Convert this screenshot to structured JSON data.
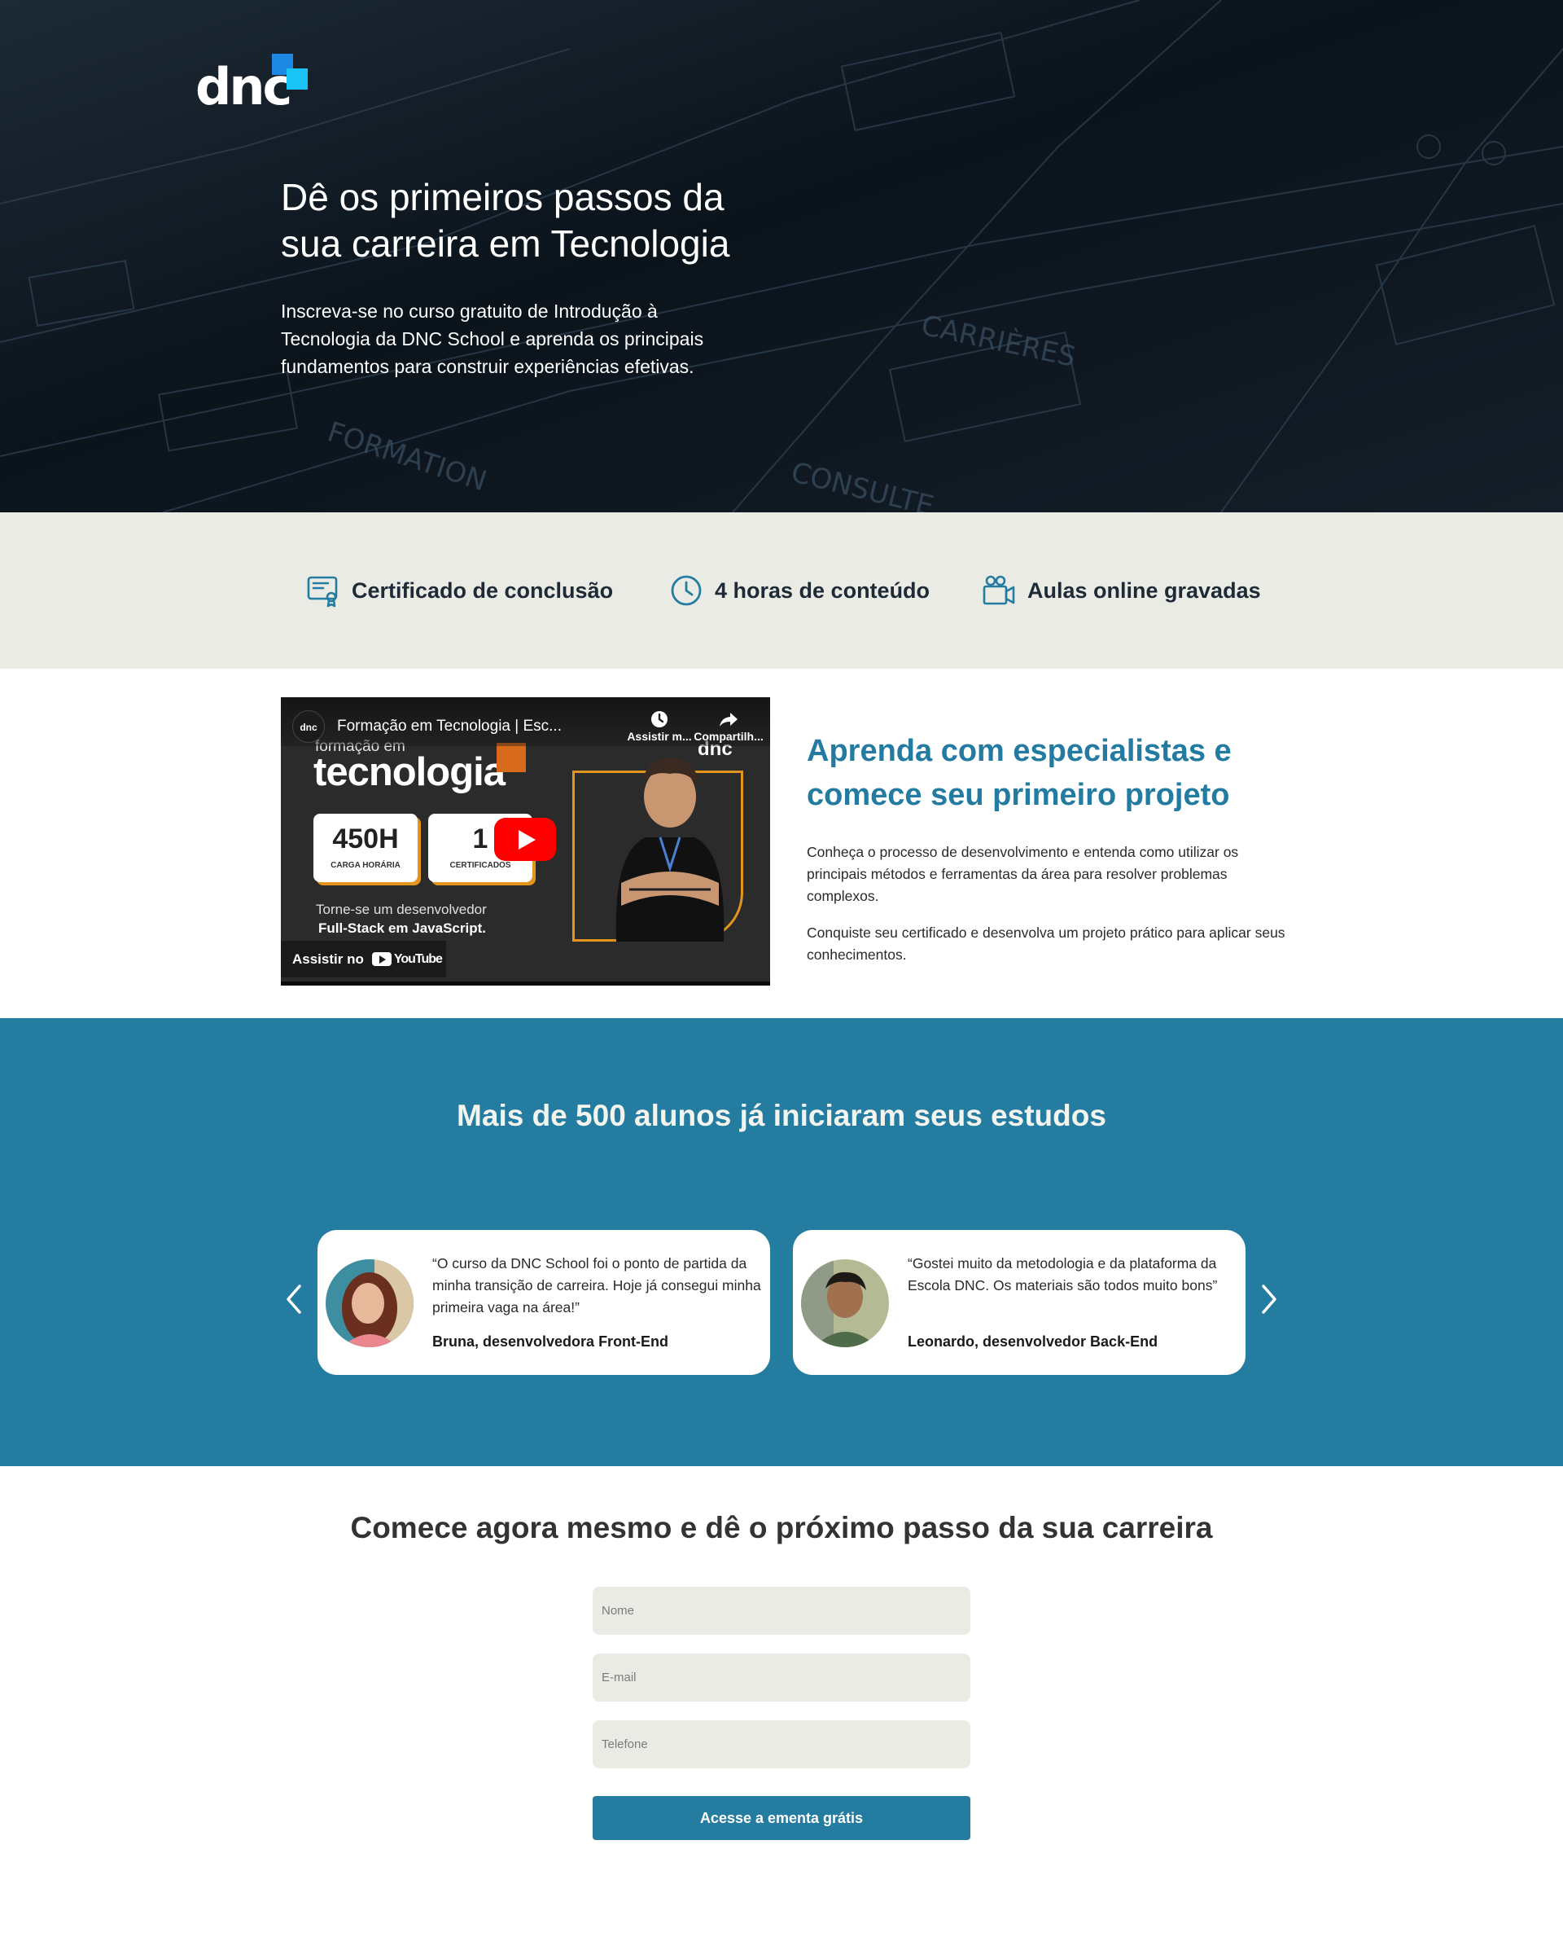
{
  "brand": {
    "logo_text": "dnc",
    "accent": "#1e88e5",
    "primary": "#247ca1"
  },
  "hero": {
    "title": "Dê os primeiros passos da sua carreira em Tecnologia",
    "subtitle": "Inscreva-se no curso gratuito de Introdução à Tecnologia da DNC School e aprenda os principais fundamentos para construir experiências efetivas."
  },
  "features": [
    {
      "icon": "certificate-icon",
      "label": "Certificado de conclusão"
    },
    {
      "icon": "clock-icon",
      "label": "4 horas de conteúdo"
    },
    {
      "icon": "video-camera-icon",
      "label": "Aulas online gravadas"
    }
  ],
  "video": {
    "channel": "dnc",
    "title": "Formação em Tecnologia | Esc...",
    "watch_later": "Assistir m...",
    "share": "Compartilh...",
    "thumb_sub": "formação em",
    "thumb_big": "tecnologia",
    "stat1_value": "450H",
    "stat1_label": "CARGA HORÁRIA",
    "stat2_value": "1",
    "stat2_label": "CERTIFICADOS",
    "tagline1": "Torne-se um desenvolvedor",
    "tagline2": "Full-Stack em JavaScript.",
    "watch_on": "Assistir no",
    "youtube": "YouTube"
  },
  "learn": {
    "title": "Aprenda com especialistas e comece seu primeiro projeto",
    "p1": "Conheça o processo de desenvolvimento e entenda como utilizar os principais métodos e ferramentas da área para resolver problemas complexos.",
    "p2": "Conquiste seu certificado e desenvolva um projeto prático para aplicar seus conhecimentos."
  },
  "testimonials": {
    "title": "Mais de 500 alunos já iniciaram seus estudos",
    "items": [
      {
        "quote": "“O curso da DNC School foi o ponto de partida da minha transição de carreira. Hoje já consegui minha primeira vaga na área!”",
        "author": "Bruna, desenvolvedora Front-End"
      },
      {
        "quote": "“Gostei muito da metodologia e da plataforma da Escola DNC. Os materiais são todos muito bons”",
        "author": "Leonardo, desenvolvedor Back-End"
      }
    ]
  },
  "form": {
    "title": "Comece agora mesmo e dê o próximo passo da sua carreira",
    "name_placeholder": "Nome",
    "email_placeholder": "E-mail",
    "phone_placeholder": "Telefone",
    "submit_label": "Acesse a ementa grátis"
  }
}
